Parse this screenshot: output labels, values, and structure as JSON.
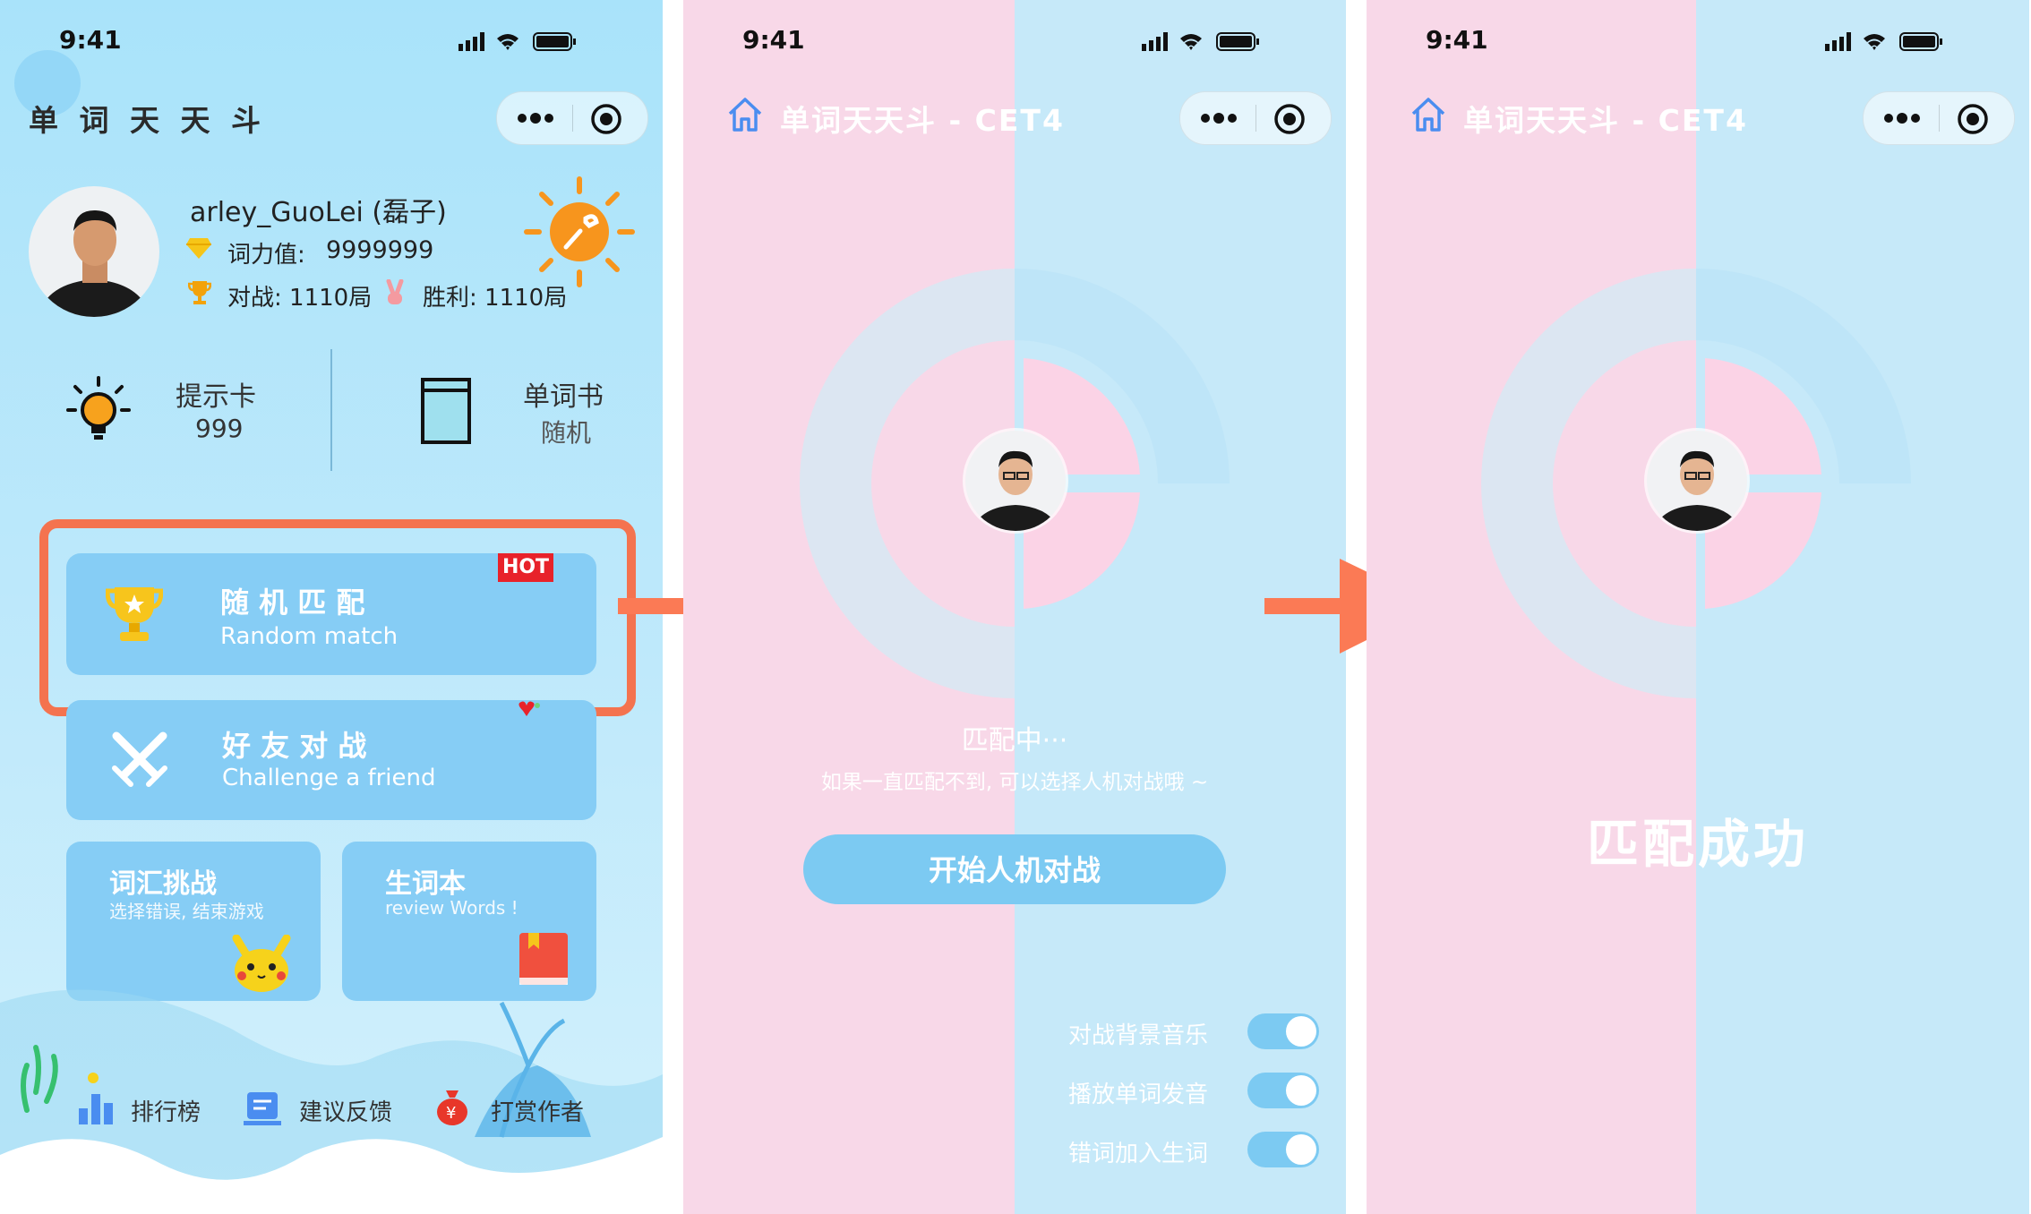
{
  "status_bar": {
    "time": "9:41"
  },
  "screen1": {
    "app_title": "单 词 天 天 斗",
    "profile": {
      "name": "arley_GuoLei (磊子)",
      "power_label": "词力值: ",
      "power_value": "9999999",
      "battles": "对战: 1110局",
      "wins": "胜利: 1110局"
    },
    "stats": {
      "hint_label": "提示卡",
      "hint_value": "999",
      "book_label": "单词书",
      "book_value": "随机"
    },
    "modes": {
      "random": {
        "title": "随 机 匹 配",
        "subtitle": "Random match",
        "badge": "HOT"
      },
      "friend": {
        "title": "好 友 对 战",
        "subtitle": "Challenge a friend"
      },
      "vocab": {
        "title": "词汇挑战",
        "subtitle": "选择错误, 结束游戏"
      },
      "review": {
        "title": "生词本",
        "subtitle": "review Words !"
      }
    },
    "bottom_nav": [
      "排行榜",
      "建议反馈",
      "打赏作者"
    ]
  },
  "screen2": {
    "title": "单词天天斗 - CET4",
    "matching": "匹配中···",
    "hint": "如果一直匹配不到, 可以选择人机对战哦 ~",
    "ai_button": "开始人机对战",
    "toggles": [
      {
        "label": "对战背景音乐",
        "on": true
      },
      {
        "label": "播放单词发音",
        "on": true
      },
      {
        "label": "错词加入生词",
        "on": true
      }
    ]
  },
  "screen3": {
    "title": "单词天天斗 - CET4",
    "success": "匹配成功"
  },
  "colors": {
    "highlight": "#f4734f",
    "arrow": "#fb7a55",
    "card": "#86cdf5",
    "pink": "#f8d8e8",
    "blue": "#c6e9f9",
    "hot": "#e8222a"
  }
}
